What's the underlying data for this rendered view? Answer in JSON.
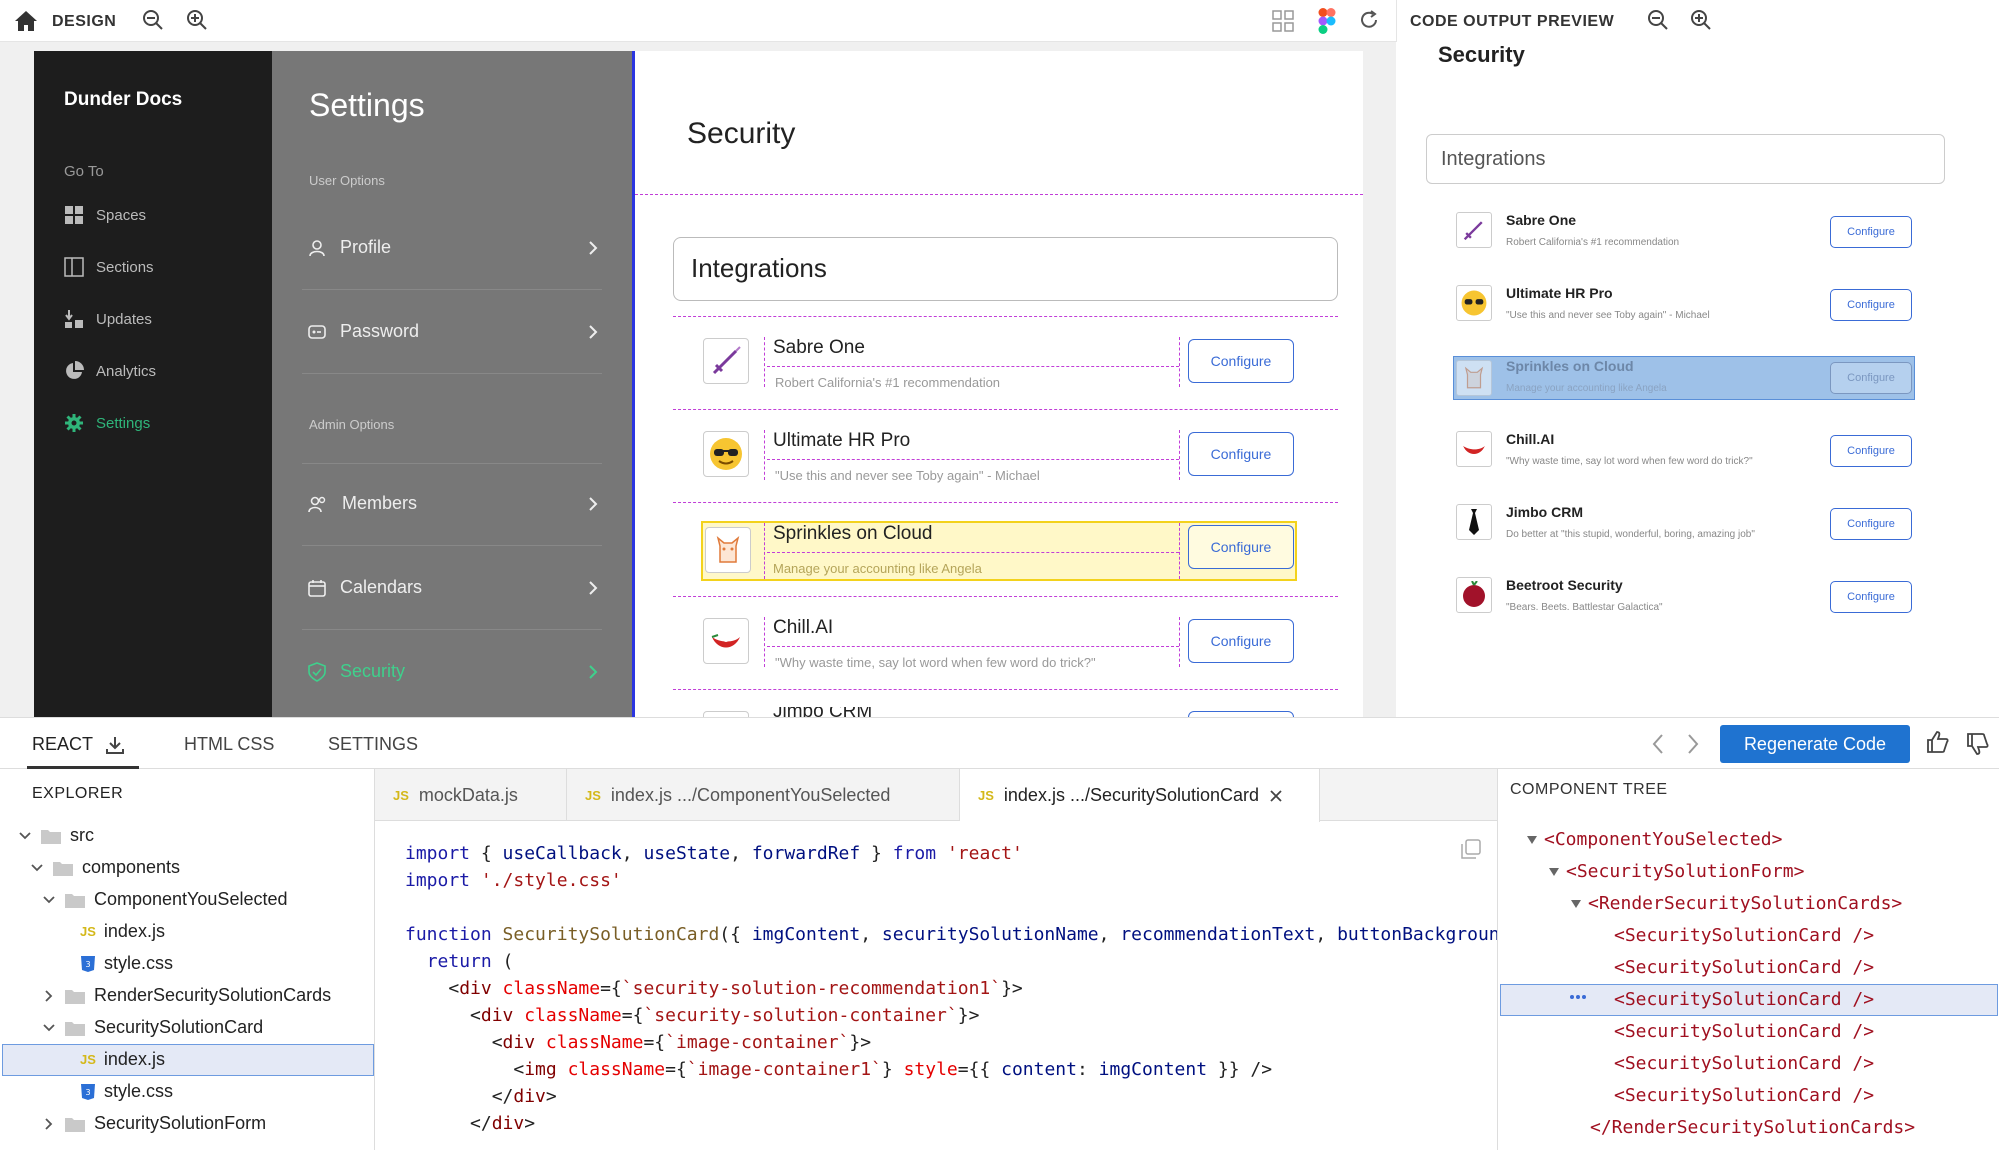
{
  "design_bar": {
    "title": "DESIGN"
  },
  "preview_bar": {
    "title": "CODE OUTPUT PREVIEW"
  },
  "mock_sidebar": {
    "brand": "Dunder Docs",
    "section": "Go To",
    "items": [
      {
        "label": "Spaces",
        "icon": "grid-icon"
      },
      {
        "label": "Sections",
        "icon": "columns-icon"
      },
      {
        "label": "Updates",
        "icon": "updates-icon"
      },
      {
        "label": "Analytics",
        "icon": "pie-chart-icon"
      },
      {
        "label": "Settings",
        "icon": "gear-icon"
      }
    ]
  },
  "mock_settings": {
    "title": "Settings",
    "user_options": "User Options",
    "admin_options": "Admin Options",
    "items": [
      {
        "label": "Profile"
      },
      {
        "label": "Password"
      },
      {
        "label": "Members"
      },
      {
        "label": "Calendars"
      },
      {
        "label": "Security"
      }
    ]
  },
  "mock_main": {
    "title": "Security",
    "integrations_label": "Integrations",
    "configure_label": "Configure",
    "cards": [
      {
        "name": "Sabre One",
        "rec": "Robert California's #1 recommendation",
        "icon": "sword-icon"
      },
      {
        "name": "Ultimate HR Pro",
        "rec": "\"Use this and never see Toby again\" - Michael",
        "icon": "sunglasses-emoji-icon"
      },
      {
        "name": "Sprinkles on Cloud",
        "rec": "Manage your accounting like Angela",
        "icon": "cat-icon"
      },
      {
        "name": "Chill.AI",
        "rec": "\"Why waste time, say lot word when few word do trick?\"",
        "icon": "chili-icon"
      },
      {
        "name": "Jimbo CRM",
        "rec": "",
        "icon": "tie-icon"
      }
    ]
  },
  "preview": {
    "title": "Security",
    "integrations_label": "Integrations",
    "configure_label": "Configure",
    "cards": [
      {
        "name": "Sabre One",
        "rec": "Robert California's #1 recommendation"
      },
      {
        "name": "Ultimate HR Pro",
        "rec": "\"Use this and never see Toby again\" - Michael"
      },
      {
        "name": "Sprinkles on Cloud",
        "rec": "Manage your accounting like Angela"
      },
      {
        "name": "Chill.AI",
        "rec": "\"Why waste time, say lot word when few word do trick?\""
      },
      {
        "name": "Jimbo CRM",
        "rec": "Do better at \"this stupid, wonderful, boring, amazing job\""
      },
      {
        "name": "Beetroot Security",
        "rec": "\"Bears. Beets. Battlestar Galactica\""
      }
    ]
  },
  "bottom_tabs": {
    "react": "REACT",
    "html_css": "HTML CSS",
    "settings": "SETTINGS",
    "regenerate": "Regenerate Code"
  },
  "explorer": {
    "title": "EXPLORER",
    "rows": [
      "src",
      "components",
      "ComponentYouSelected",
      "index.js",
      "style.css",
      "RenderSecuritySolutionCards",
      "SecuritySolutionCard",
      "index.js",
      "style.css",
      "SecuritySolutionForm"
    ]
  },
  "editor": {
    "tabs": [
      {
        "label": "mockData.js"
      },
      {
        "label": "index.js .../ComponentYouSelected"
      },
      {
        "label": "index.js .../SecuritySolutionCard"
      }
    ],
    "file_badge": "JS"
  },
  "component_tree": {
    "title": "COMPONENT TREE",
    "rows": [
      "<ComponentYouSelected>",
      "<SecuritySolutionForm>",
      "<RenderSecuritySolutionCards>",
      "<SecuritySolutionCard />",
      "<SecuritySolutionCard />",
      "<SecuritySolutionCard />",
      "<SecuritySolutionCard />",
      "<SecuritySolutionCard />",
      "<SecuritySolutionCard />",
      "</RenderSecuritySolutionCards>"
    ]
  }
}
